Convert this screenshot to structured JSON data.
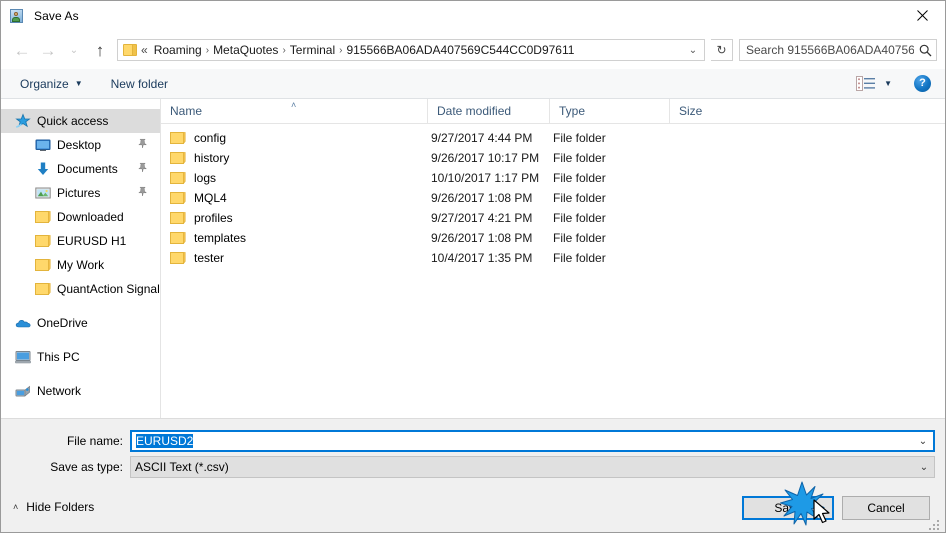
{
  "window": {
    "title": "Save As",
    "icon": "save-as-app-icon",
    "close_label": "✕"
  },
  "nav": {
    "back": "←",
    "forward": "→",
    "recent": "⌄",
    "up": "↑",
    "refresh": "↻",
    "dropdown": "⌄",
    "breadcrumb_prefix": "«",
    "breadcrumbs": [
      "Roaming",
      "MetaQuotes",
      "Terminal",
      "915566BA06ADA407569C544CC0D97611"
    ],
    "separator": "›"
  },
  "search": {
    "placeholder": "Search 915566BA06ADA40756...",
    "icon": "search-icon"
  },
  "toolbar": {
    "organize": "Organize",
    "organize_caret": "▼",
    "new_folder": "New folder",
    "view_caret": "▼",
    "help": "?"
  },
  "sidebar": {
    "items": [
      {
        "label": "Quick access",
        "icon": "quick-access-star-icon",
        "selected": true,
        "pinned": false,
        "indent": "root"
      },
      {
        "label": "Desktop",
        "icon": "desktop-icon",
        "selected": false,
        "pinned": true,
        "indent": "child"
      },
      {
        "label": "Documents",
        "icon": "documents-download-icon",
        "selected": false,
        "pinned": true,
        "indent": "child"
      },
      {
        "label": "Pictures",
        "icon": "pictures-icon",
        "selected": false,
        "pinned": true,
        "indent": "child"
      },
      {
        "label": "Downloaded",
        "icon": "folder-icon",
        "selected": false,
        "pinned": false,
        "indent": "child"
      },
      {
        "label": "EURUSD H1",
        "icon": "folder-icon",
        "selected": false,
        "pinned": false,
        "indent": "child"
      },
      {
        "label": "My Work",
        "icon": "folder-icon",
        "selected": false,
        "pinned": false,
        "indent": "child"
      },
      {
        "label": "QuantAction Signal",
        "icon": "folder-icon",
        "selected": false,
        "pinned": false,
        "indent": "child"
      },
      {
        "label": "OneDrive",
        "icon": "onedrive-cloud-icon",
        "selected": false,
        "pinned": false,
        "indent": "root",
        "group_gap": true
      },
      {
        "label": "This PC",
        "icon": "this-pc-icon",
        "selected": false,
        "pinned": false,
        "indent": "root",
        "group_gap": true
      },
      {
        "label": "Network",
        "icon": "network-icon",
        "selected": false,
        "pinned": false,
        "indent": "root",
        "group_gap": true
      }
    ],
    "pin_glyph": "📌"
  },
  "filelist": {
    "columns": [
      {
        "label": "Name",
        "sorted": true,
        "sort_caret": "˄"
      },
      {
        "label": "Date modified",
        "sorted": false
      },
      {
        "label": "Type",
        "sorted": false
      },
      {
        "label": "Size",
        "sorted": false
      }
    ],
    "rows": [
      {
        "name": "config",
        "date": "9/27/2017 4:44 PM",
        "type": "File folder",
        "size": ""
      },
      {
        "name": "history",
        "date": "9/26/2017 10:17 PM",
        "type": "File folder",
        "size": ""
      },
      {
        "name": "logs",
        "date": "10/10/2017 1:17 PM",
        "type": "File folder",
        "size": ""
      },
      {
        "name": "MQL4",
        "date": "9/26/2017 1:08 PM",
        "type": "File folder",
        "size": ""
      },
      {
        "name": "profiles",
        "date": "9/27/2017 4:21 PM",
        "type": "File folder",
        "size": ""
      },
      {
        "name": "templates",
        "date": "9/26/2017 1:08 PM",
        "type": "File folder",
        "size": ""
      },
      {
        "name": "tester",
        "date": "10/4/2017 1:35 PM",
        "type": "File folder",
        "size": ""
      }
    ]
  },
  "form": {
    "filename_label": "File name:",
    "filename_value": "EURUSD2",
    "filename_selected": true,
    "savetype_label": "Save as type:",
    "savetype_value": "ASCII Text (*.csv)",
    "combo_arrow": "⌄"
  },
  "footer": {
    "hide_folders": "Hide Folders",
    "hide_folders_caret": "˄",
    "save": "Save",
    "cancel": "Cancel"
  },
  "colors": {
    "accent": "#0078d7",
    "folder_yellow": "#ffd86b",
    "selection": "#dcdcdc",
    "header_text": "#3c5a79",
    "dialog_bg": "#f0f0f0"
  }
}
